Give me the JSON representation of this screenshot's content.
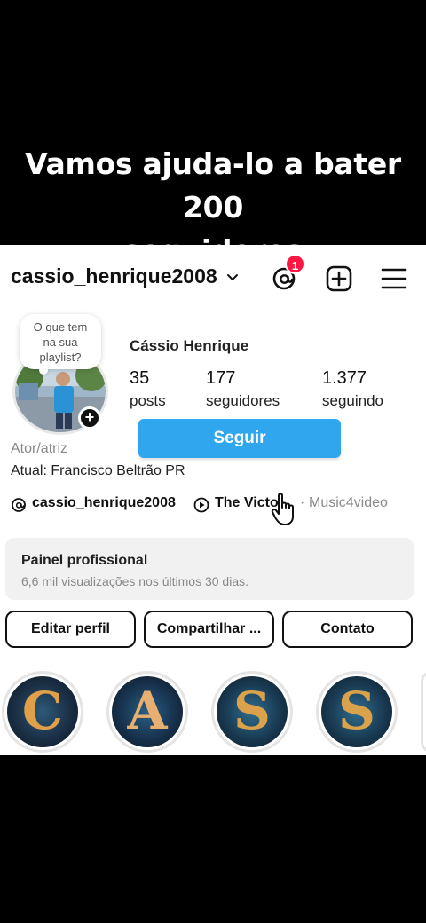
{
  "overlay": {
    "caption_line1": "Vamos ajuda-lo a bater 200",
    "caption_line2": "seguidores"
  },
  "header": {
    "username": "cassio_henrique2008",
    "notification_count": "1"
  },
  "note": {
    "line1": "O que tem",
    "line2": "na sua",
    "line3": "playlist?"
  },
  "profile": {
    "full_name": "Cássio Henrique",
    "stats": [
      {
        "value": "35",
        "label": "posts"
      },
      {
        "value": "177",
        "label": "seguidores"
      },
      {
        "value": "1.377",
        "label": "seguindo"
      }
    ],
    "follow_label": "Seguir",
    "category": "Ator/atriz",
    "location": "Atual: Francisco Beltrão PR"
  },
  "links": {
    "threads": "cassio_henrique2008",
    "video": "The Victo",
    "extra": "Music4video"
  },
  "professional_panel": {
    "title": "Painel profissional",
    "subtitle": "6,6 mil visualizações nos últimos 30 dias."
  },
  "actions": {
    "edit": "Editar perfil",
    "share": "Compartilhar ...",
    "contact": "Contato"
  },
  "stories": [
    {
      "letter": "C",
      "color": "#e0a04a"
    },
    {
      "letter": "A",
      "color": "#e8b070"
    },
    {
      "letter": "S",
      "color": "#d9a24b"
    },
    {
      "letter": "S",
      "color": "#d9a24b"
    }
  ],
  "colors": {
    "follow_blue": "#2fa6ee",
    "badge_red": "#ff1744"
  }
}
